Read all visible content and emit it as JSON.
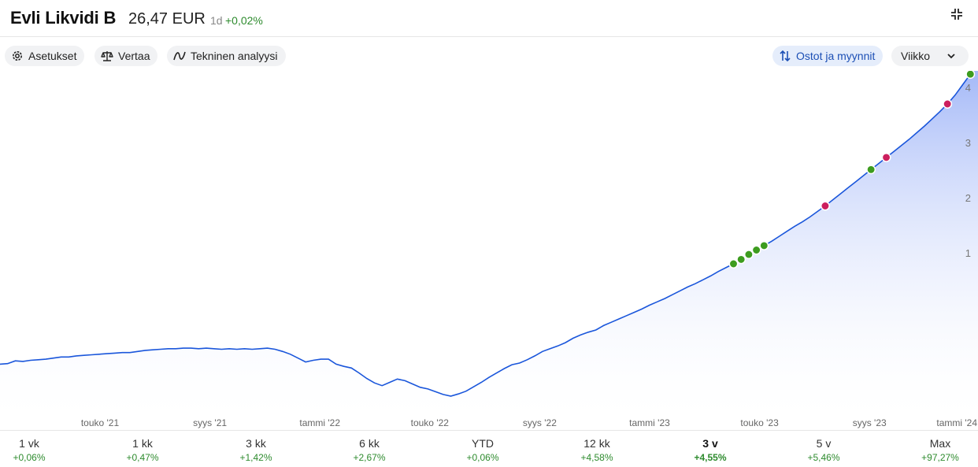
{
  "header": {
    "title": "Evli Likvidi B",
    "price": "26,47 EUR",
    "period": "1d",
    "delta": "+0,02%"
  },
  "toolbar": {
    "settings_label": "Asetukset",
    "compare_label": "Vertaa",
    "technical_label": "Tekninen analyysi",
    "trades_label": "Ostot ja myynnit",
    "interval_value": "Viikko"
  },
  "chart_data": {
    "type": "area",
    "x_tick_labels": [
      "touko '21",
      "syys '21",
      "tammi '22",
      "touko '22",
      "syys '22",
      "tammi '23",
      "touko '23",
      "syys '23",
      "tammi '24"
    ],
    "y_tick_labels": [
      "1",
      "2",
      "3",
      "4"
    ],
    "y_axis_position": "right",
    "grid": false,
    "series": [
      {
        "values": [
          -1.02,
          -1.01,
          -0.96,
          -0.97,
          -0.95,
          -0.94,
          -0.93,
          -0.91,
          -0.89,
          -0.89,
          -0.87,
          -0.86,
          -0.85,
          -0.84,
          -0.83,
          -0.82,
          -0.81,
          -0.81,
          -0.79,
          -0.77,
          -0.76,
          -0.75,
          -0.74,
          -0.74,
          -0.73,
          -0.73,
          -0.74,
          -0.73,
          -0.74,
          -0.75,
          -0.74,
          -0.75,
          -0.74,
          -0.75,
          -0.74,
          -0.73,
          -0.75,
          -0.79,
          -0.84,
          -0.91,
          -0.98,
          -0.95,
          -0.93,
          -0.93,
          -1.02,
          -1.06,
          -1.09,
          -1.18,
          -1.28,
          -1.36,
          -1.41,
          -1.35,
          -1.29,
          -1.32,
          -1.38,
          -1.44,
          -1.47,
          -1.52,
          -1.57,
          -1.6,
          -1.56,
          -1.51,
          -1.43,
          -1.35,
          -1.26,
          -1.18,
          -1.1,
          -1.03,
          -1.0,
          -0.94,
          -0.87,
          -0.79,
          -0.74,
          -0.69,
          -0.63,
          -0.55,
          -0.49,
          -0.44,
          -0.4,
          -0.32,
          -0.26,
          -0.2,
          -0.14,
          -0.08,
          -0.02,
          0.05,
          0.11,
          0.17,
          0.24,
          0.31,
          0.38,
          0.44,
          0.51,
          0.58,
          0.66,
          0.73,
          0.8,
          0.88,
          0.97,
          1.05,
          1.13,
          1.21,
          1.3,
          1.39,
          1.48,
          1.56,
          1.65,
          1.75,
          1.85,
          1.96,
          2.07,
          2.18,
          2.29,
          2.4,
          2.51,
          2.62,
          2.73,
          2.84,
          2.95,
          3.06,
          3.18,
          3.3,
          3.43,
          3.56,
          3.7,
          3.86,
          4.05,
          4.24,
          4.4
        ]
      }
    ],
    "trade_markers": [
      {
        "index": 96,
        "type": "buy"
      },
      {
        "index": 97,
        "type": "buy"
      },
      {
        "index": 98,
        "type": "buy"
      },
      {
        "index": 99,
        "type": "buy"
      },
      {
        "index": 100,
        "type": "buy"
      },
      {
        "index": 108,
        "type": "sell"
      },
      {
        "index": 114,
        "type": "buy"
      },
      {
        "index": 116,
        "type": "sell"
      },
      {
        "index": 124,
        "type": "sell"
      },
      {
        "index": 127,
        "type": "buy"
      }
    ],
    "colors": {
      "line": "#1a56db",
      "fill_top": "#9db3f7",
      "buy": "#3d9c1f",
      "sell": "#cc1f5e"
    }
  },
  "ranges": [
    {
      "label": "1 vk",
      "value": "+0,06%",
      "active": false
    },
    {
      "label": "1 kk",
      "value": "+0,47%",
      "active": false
    },
    {
      "label": "3 kk",
      "value": "+1,42%",
      "active": false
    },
    {
      "label": "6 kk",
      "value": "+2,67%",
      "active": false
    },
    {
      "label": "YTD",
      "value": "+0,06%",
      "active": false
    },
    {
      "label": "12 kk",
      "value": "+4,58%",
      "active": false
    },
    {
      "label": "3 v",
      "value": "+4,55%",
      "active": true
    },
    {
      "label": "5 v",
      "value": "+5,46%",
      "active": false
    },
    {
      "label": "Max",
      "value": "+97,27%",
      "active": false
    }
  ]
}
